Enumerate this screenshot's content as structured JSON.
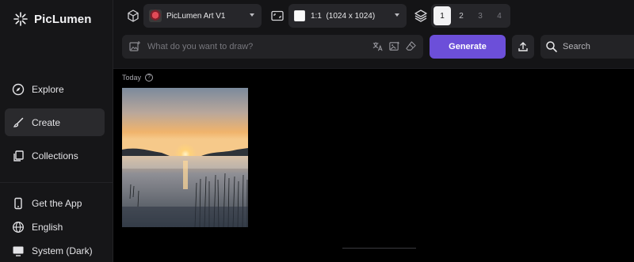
{
  "app": {
    "name": "PicLumen"
  },
  "sidebar": {
    "items": [
      {
        "label": "Explore",
        "icon": "compass-icon",
        "active": false
      },
      {
        "label": "Create",
        "icon": "brush-icon",
        "active": true
      },
      {
        "label": "Collections",
        "icon": "collections-icon",
        "active": false
      }
    ],
    "footer": [
      {
        "label": "Get the App",
        "icon": "phone-icon"
      },
      {
        "label": "English",
        "icon": "globe-icon"
      },
      {
        "label": "System (Dark)",
        "icon": "monitor-icon"
      }
    ]
  },
  "toolbar": {
    "model": {
      "label": "PicLumen Art V1",
      "icon": "cube-icon"
    },
    "aspect_ratio": {
      "label": "1:1  (1024 x 1024)",
      "icon": "aspect-ratio-icon"
    },
    "image_count": {
      "icon": "layers-icon",
      "options": [
        "1",
        "2",
        "3",
        "4"
      ],
      "selected": "1"
    },
    "prompt": {
      "placeholder": "What do you want to draw?",
      "value": ""
    },
    "generate_label": "Generate",
    "search": {
      "placeholder": "Search",
      "value": ""
    }
  },
  "gallery": {
    "group_label": "Today",
    "items": [
      {
        "description_icon": "image-thumbnail"
      }
    ]
  },
  "colors": {
    "accent": "#6c4fd9",
    "sidebar_bg": "#161618",
    "canvas_bg": "#000000"
  }
}
